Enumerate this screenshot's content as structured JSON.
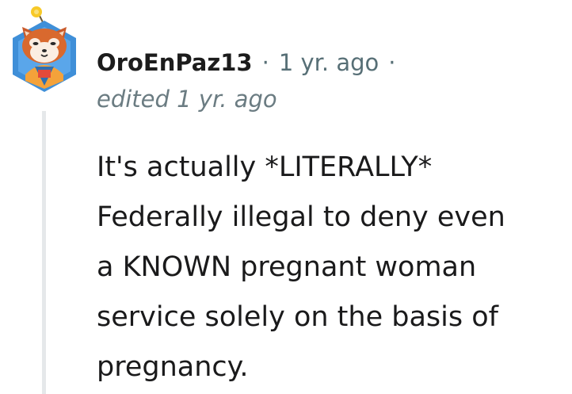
{
  "comment": {
    "author": "OroEnPaz13",
    "separator": "·",
    "timestamp": "1 yr. ago",
    "trailing_separator": "·",
    "edited": "edited 1 yr. ago",
    "body_lines": [
      "It's actually *LITERALLY*",
      "Federally illegal to deny even",
      "a KNOWN pregnant woman",
      "service solely on the basis of",
      "pregnancy."
    ]
  },
  "avatar": {
    "icon": "red-panda-avatar-icon",
    "frame_color": "#3f8fd8",
    "accent_color": "#f7c928"
  },
  "colors": {
    "username": "#1c1c1c",
    "meta": "#576f76",
    "body_text": "#1a1a1b",
    "thread_line": "#e5e8ea"
  }
}
